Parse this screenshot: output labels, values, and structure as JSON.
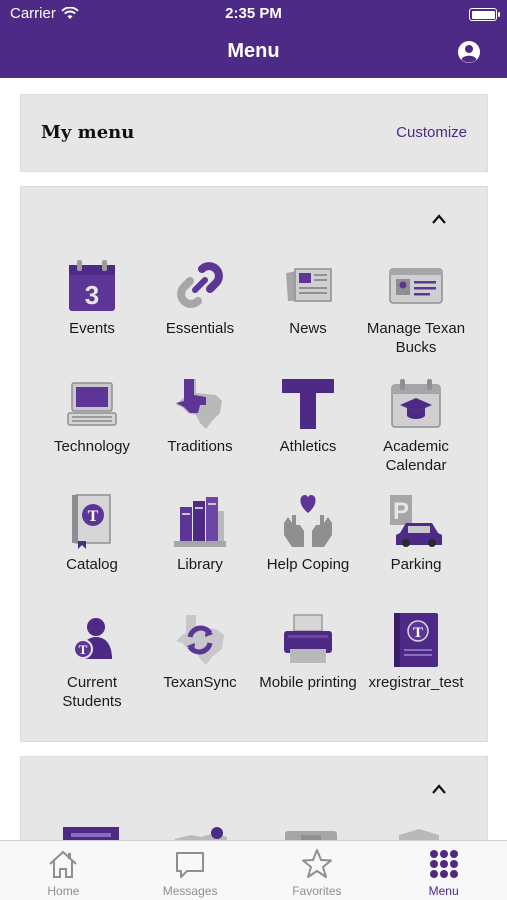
{
  "status_bar": {
    "carrier": "Carrier",
    "time": "2:35 PM"
  },
  "nav": {
    "title": "Menu",
    "profile_icon": "user-circle-icon"
  },
  "my_menu": {
    "heading": "My menu",
    "customize_label": "Customize"
  },
  "grid": {
    "collapse_icon": "chevron-up-icon",
    "items": [
      {
        "label": "Events",
        "icon": "calendar-3-icon"
      },
      {
        "label": "Essentials",
        "icon": "chain-link-icon"
      },
      {
        "label": "News",
        "icon": "newspaper-icon"
      },
      {
        "label": "Manage Texan Bucks",
        "icon": "id-card-icon"
      },
      {
        "label": "Technology",
        "icon": "computer-icon"
      },
      {
        "label": "Traditions",
        "icon": "texas-map-icon"
      },
      {
        "label": "Athletics",
        "icon": "letter-t-icon"
      },
      {
        "label": "Academic Calendar",
        "icon": "graduation-calendar-icon"
      },
      {
        "label": "Catalog",
        "icon": "catalog-book-icon"
      },
      {
        "label": "Library",
        "icon": "books-icon"
      },
      {
        "label": "Help Coping",
        "icon": "hands-heart-icon"
      },
      {
        "label": "Parking",
        "icon": "parking-car-icon"
      },
      {
        "label": "Current Students",
        "icon": "student-icon"
      },
      {
        "label": "TexanSync",
        "icon": "sync-map-icon"
      },
      {
        "label": "Mobile printing",
        "icon": "printer-icon"
      },
      {
        "label": "xregistrar_test",
        "icon": "registrar-book-icon"
      }
    ]
  },
  "tabs": [
    {
      "label": "Home",
      "icon": "home-icon",
      "active": false
    },
    {
      "label": "Messages",
      "icon": "chat-bubble-icon",
      "active": false
    },
    {
      "label": "Favorites",
      "icon": "star-icon",
      "active": false
    },
    {
      "label": "Menu",
      "icon": "grid-dots-icon",
      "active": true
    }
  ],
  "colors": {
    "brand_purple": "#4c2a85",
    "card_gray": "#e6e6e7",
    "icon_gray": "#a6a6a8"
  }
}
